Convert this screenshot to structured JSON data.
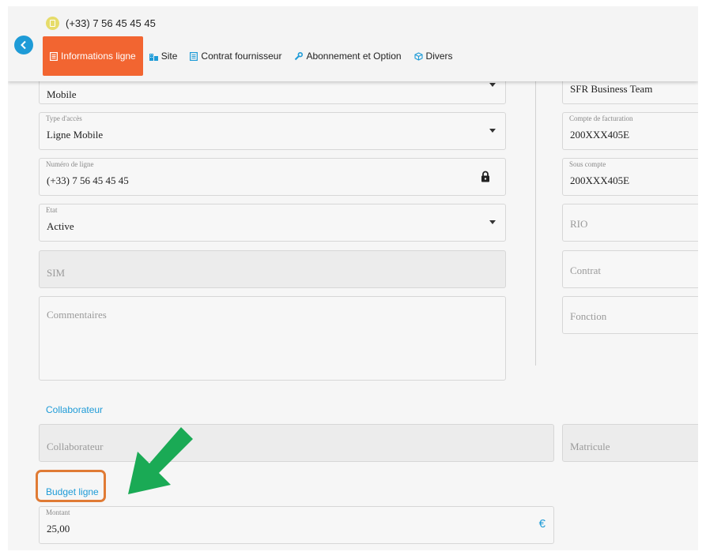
{
  "header": {
    "phone": "(+33) 7 56 45 45 45",
    "tabs": [
      {
        "label": "Informations ligne",
        "icon": "document-icon",
        "active": true
      },
      {
        "label": "Site",
        "icon": "building-icon"
      },
      {
        "label": "Contrat fournisseur",
        "icon": "document-icon"
      },
      {
        "label": "Abonnement et Option",
        "icon": "wrench-icon"
      },
      {
        "label": "Divers",
        "icon": "box-icon"
      }
    ]
  },
  "left": {
    "type_ligne": {
      "value": "Mobile"
    },
    "type_acces": {
      "label": "Type d'accès",
      "value": "Ligne Mobile"
    },
    "numero": {
      "label": "Numéro de ligne",
      "value": "(+33) 7 56 45 45 45"
    },
    "etat": {
      "label": "Etat",
      "value": "Active"
    },
    "sim": {
      "placeholder": "SIM"
    },
    "commentaires": {
      "placeholder": "Commentaires"
    }
  },
  "right": {
    "operateur": {
      "value": "SFR Business Team"
    },
    "compte": {
      "label": "Compte de facturation",
      "value": "200XXX405E"
    },
    "sous_compte": {
      "label": "Sous compte",
      "value": "200XXX405E"
    },
    "rio": {
      "placeholder": "RIO"
    },
    "contrat": {
      "placeholder": "Contrat"
    },
    "fonction": {
      "placeholder": "Fonction"
    }
  },
  "collaborateur": {
    "title": "Collaborateur",
    "field_placeholder": "Collaborateur",
    "matricule_placeholder": "Matricule"
  },
  "budget": {
    "title": "Budget ligne",
    "montant_label": "Montant",
    "montant_value": "25,00",
    "currency": "€"
  },
  "colors": {
    "accent": "#1e9bd7",
    "active_tab": "#f26531",
    "highlight": "#e07b35",
    "arrow": "#1aaa55"
  }
}
